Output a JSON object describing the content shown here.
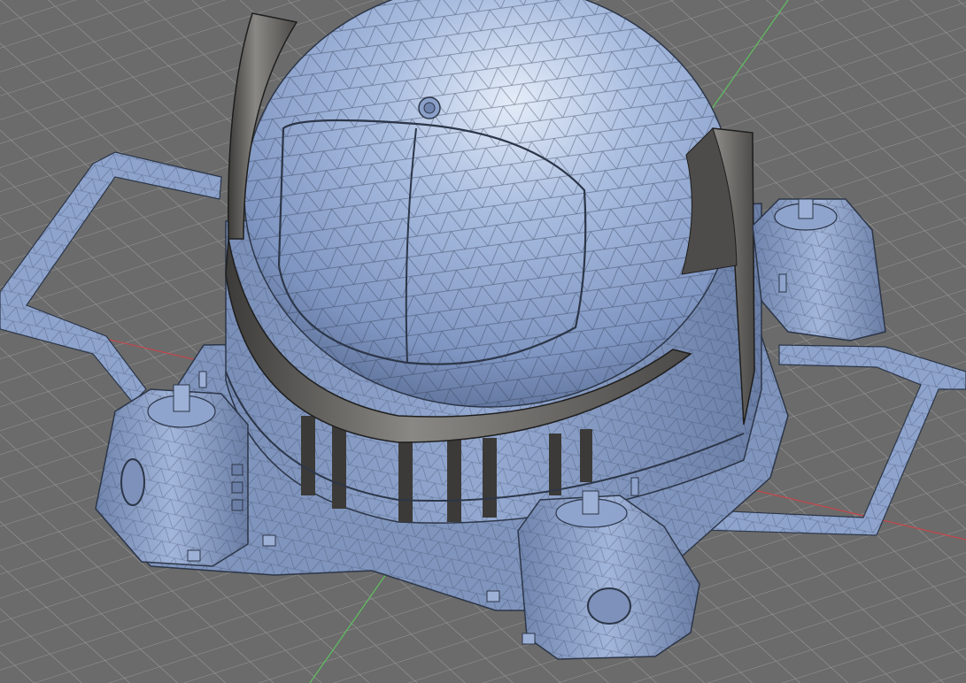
{
  "viewport": {
    "background": "#6c6c6c",
    "grid_color": "#9a9a9a",
    "x_axis_color": "#c8454a",
    "y_axis_color": "#5fc05f"
  },
  "model": {
    "surface_color": "#8ea4cd",
    "surface_light": "#b9c8e6",
    "surface_dark": "#5d7096",
    "frame_color": "#6f6d6a",
    "wire_color": "#2c3648",
    "parts": [
      "dome",
      "shell",
      "base",
      "pod-left",
      "pod-right",
      "pod-front",
      "frame-left",
      "frame-right"
    ]
  }
}
